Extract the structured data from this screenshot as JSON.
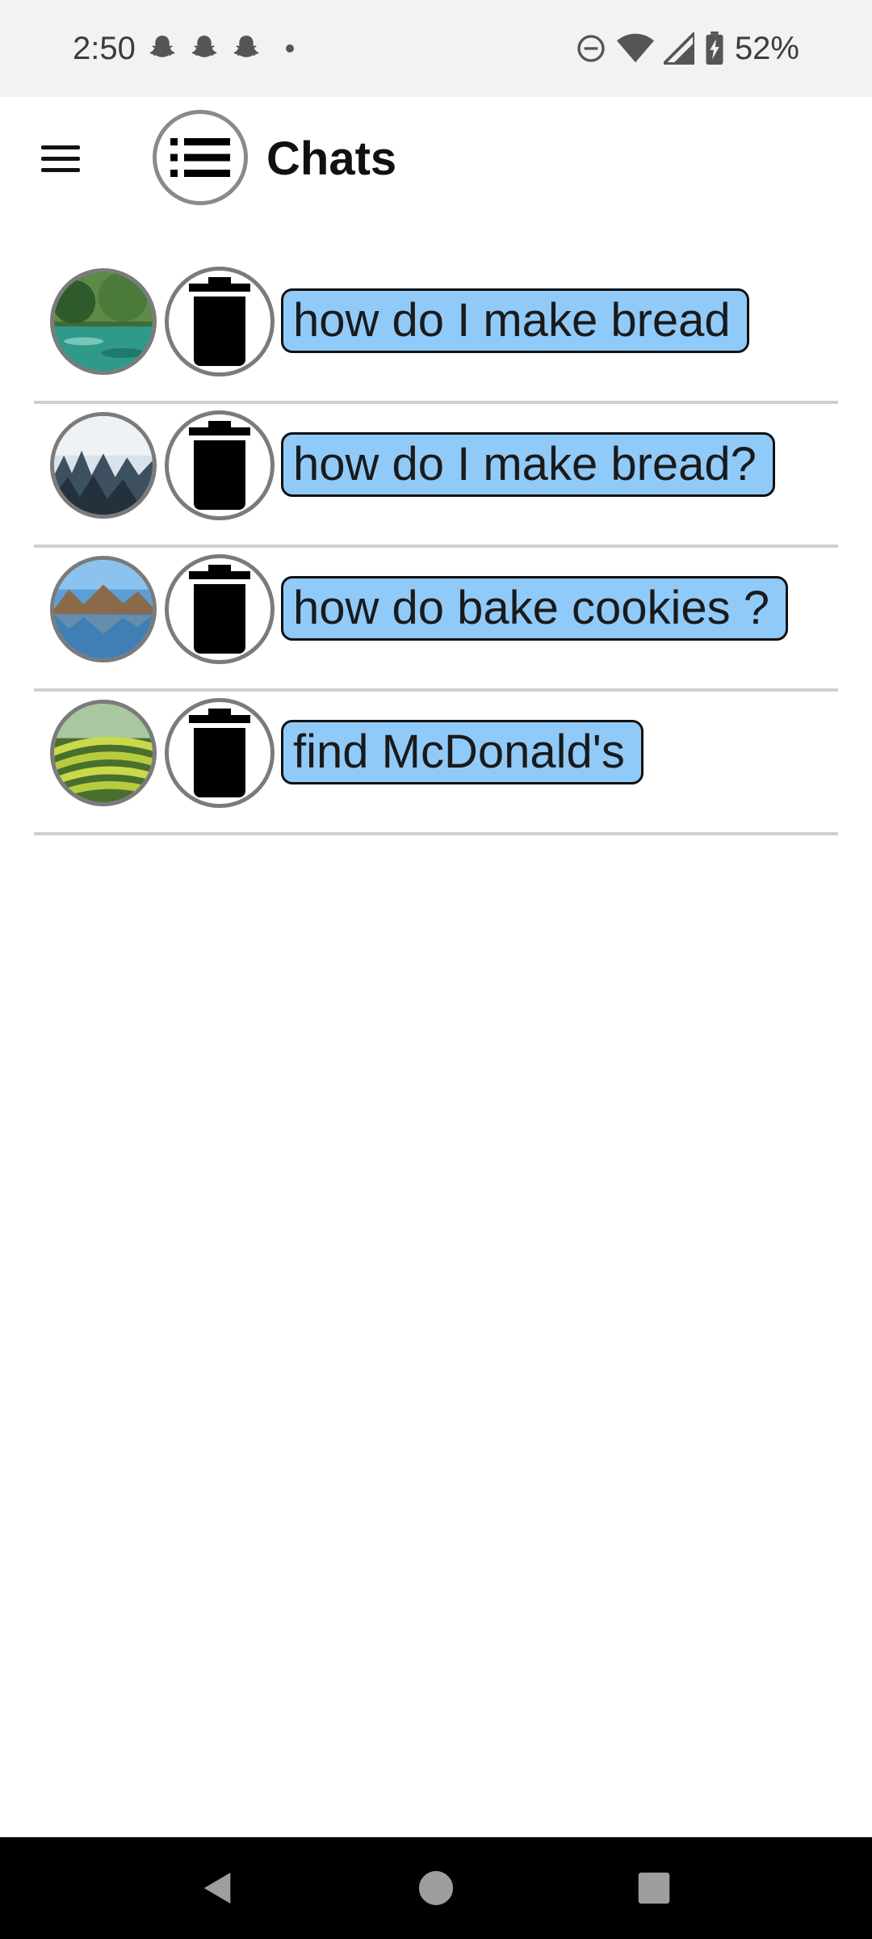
{
  "status_bar": {
    "time": "2:50",
    "battery": "52%",
    "icons": [
      "snapchat-icon",
      "snapchat-icon",
      "snapchat-icon",
      "dot-icon",
      "do-not-disturb-icon",
      "wifi-icon",
      "cell-signal-icon",
      "battery-charging-icon"
    ]
  },
  "app_bar": {
    "title": "Chats",
    "menu_icon": "hamburger-menu-icon",
    "list_icon": "list-icon"
  },
  "chats": [
    {
      "title": "how do I make bread",
      "avatar": "river-forest-image",
      "delete_icon": "trash-icon"
    },
    {
      "title": "how do I make bread?",
      "avatar": "misty-forest-image",
      "delete_icon": "trash-icon"
    },
    {
      "title": "how do bake cookies ?",
      "avatar": "mountain-lake-image",
      "delete_icon": "trash-icon"
    },
    {
      "title": "find McDonald's",
      "avatar": "rice-terraces-image",
      "delete_icon": "trash-icon"
    }
  ],
  "nav_bar": {
    "buttons": [
      "back-icon",
      "home-icon",
      "recents-icon"
    ]
  },
  "colors": {
    "chat_title_bg": "#90caf9",
    "status_bar_bg": "#f2f2f2",
    "nav_bar_bg": "#000000",
    "divider": "#cfcfcf"
  }
}
